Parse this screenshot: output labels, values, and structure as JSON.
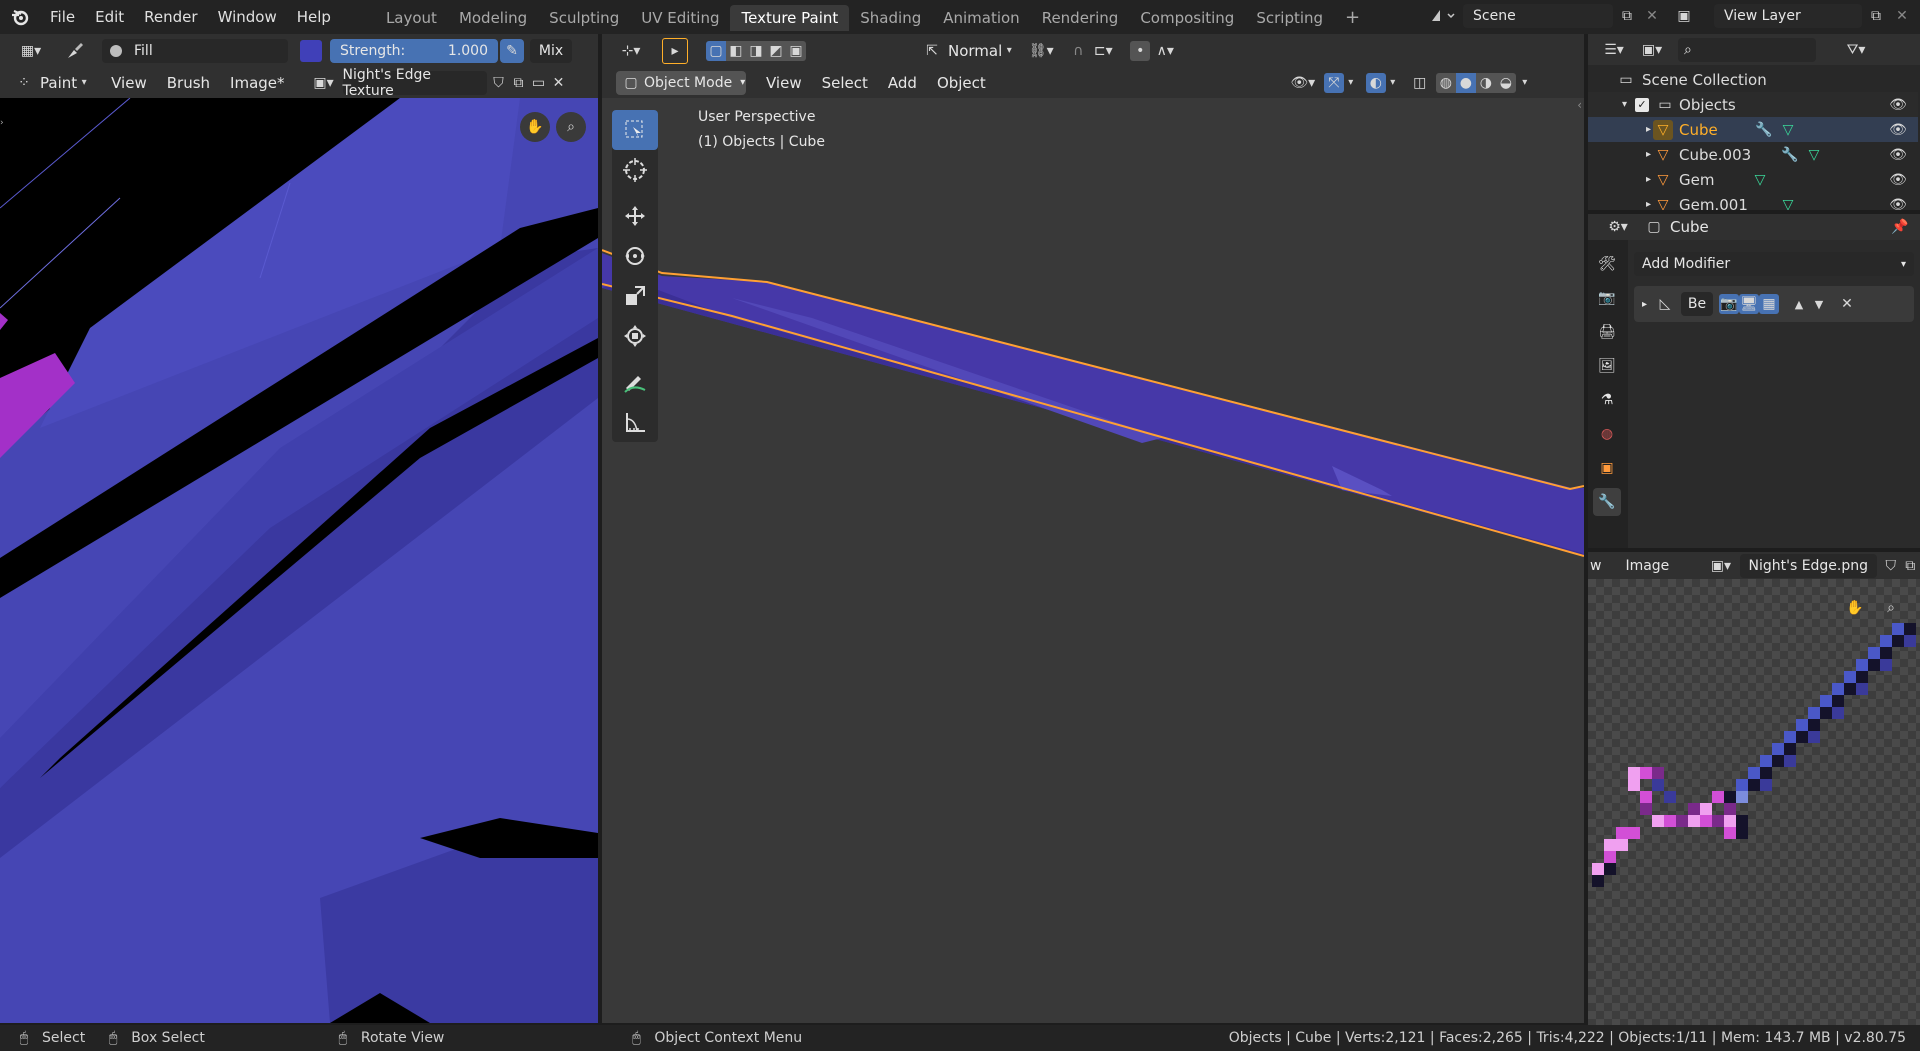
{
  "menubar": {
    "menus": [
      "File",
      "Edit",
      "Render",
      "Window",
      "Help"
    ],
    "workspaces": [
      "Layout",
      "Modeling",
      "Sculpting",
      "UV Editing",
      "Texture Paint",
      "Shading",
      "Animation",
      "Rendering",
      "Compositing",
      "Scripting"
    ],
    "active_workspace": "Texture Paint",
    "add_tab": "+",
    "scene": "Scene",
    "view_layer": "View Layer"
  },
  "image_editor": {
    "brush_name": "Fill",
    "brush_color": "#4040b8",
    "strength_label": "Strength:",
    "strength_value": "1.000",
    "blend_mode": "Mix",
    "mode": "Paint",
    "menus": [
      "View",
      "Brush",
      "Image*"
    ],
    "image_name": "Night's Edge Texture"
  },
  "viewport": {
    "shading_mode": "Normal",
    "object_mode": "Object Mode",
    "menus": [
      "View",
      "Select",
      "Add",
      "Object"
    ],
    "perspective": "User Perspective",
    "context": "(1) Objects | Cube"
  },
  "outliner": {
    "collection": "Scene Collection",
    "items": [
      {
        "name": "Objects",
        "type": "collection"
      },
      {
        "name": "Cube",
        "type": "mesh",
        "active": true
      },
      {
        "name": "Cube.003",
        "type": "mesh"
      },
      {
        "name": "Gem",
        "type": "mesh"
      },
      {
        "name": "Gem.001",
        "type": "mesh"
      }
    ]
  },
  "properties": {
    "object": "Cube",
    "add_modifier": "Add Modifier",
    "modifier_name": "Be"
  },
  "image_preview": {
    "header_left": "w",
    "menu": "Image",
    "image_name": "Night's Edge.png"
  },
  "statusbar": {
    "select": "Select",
    "box_select": "Box Select",
    "rotate_view": "Rotate View",
    "context_menu": "Object Context Menu",
    "stats": "Objects | Cube | Verts:2,121 | Faces:2,265 | Tris:4,222 | Objects:1/11 | Mem: 143.7 MB | v2.80.75"
  },
  "colors": {
    "accent": "#4772b3",
    "active_orange": "#ffaf29",
    "mesh_purple": "#4638a8",
    "paint_blue": "#4848c0"
  }
}
